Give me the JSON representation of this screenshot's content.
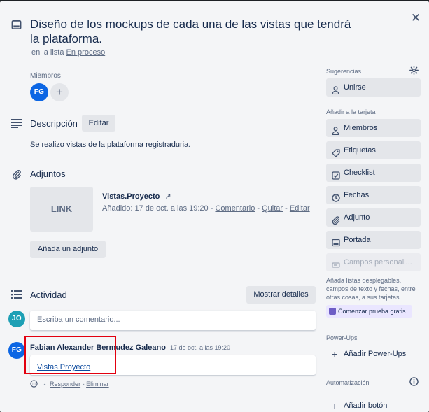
{
  "card": {
    "title": "Diseño de los mockups de cada una de las vistas que tendrá la plataforma.",
    "list_prefix": "en la lista",
    "list_name": "En proceso"
  },
  "members": {
    "label": "Miembros",
    "avatar_initials": "FG",
    "add_symbol": "+"
  },
  "description": {
    "title": "Descripción",
    "edit_label": "Editar",
    "text": "Se realizo vistas de la plataforma registraduria."
  },
  "attachments": {
    "title": "Adjuntos",
    "thumb_label": "LINK",
    "name": "Vistas.Proyecto",
    "arrow": "↗",
    "added": "Añadido: 17 de oct. a las 19:20",
    "sep": "-",
    "comment_link": "Comentario",
    "remove_link": "Quitar",
    "edit_link": "Editar",
    "add_button": "Añada un adjunto"
  },
  "activity": {
    "title": "Actividad",
    "details_button": "Mostrar detalles",
    "input_avatar": "JO",
    "input_placeholder": "Escriba un comentario...",
    "comment": {
      "avatar": "FG",
      "author": "Fabian Alexander Bermudez Galeano",
      "time": "17 de oct. a las 19:20",
      "link_text": "Vistas.Proyecto",
      "sep": "-",
      "reply": "Responder",
      "delete": "Eliminar"
    }
  },
  "sidebar": {
    "suggestions_title": "Sugerencias",
    "join_label": "Unirse",
    "add_to_card_title": "Añadir a la tarjeta",
    "add_items": [
      "Miembros",
      "Etiquetas",
      "Checklist",
      "Fechas",
      "Adjunto",
      "Portada"
    ],
    "custom_fields_label": "Campos personali...",
    "custom_fields_help": "Añada listas desplegables, campos de texto y fechas, entre otras cosas, a sus tarjetas.",
    "trial_label": "Comenzar prueba gratis",
    "powerups_title": "Power-Ups",
    "add_powerups": "Añadir Power-Ups",
    "automation_title": "Automatización",
    "add_button_label": "Añadir botón"
  },
  "colors": {
    "avatar_fg": "#0c66e4",
    "avatar_jo": "#1ea0b5",
    "highlight": "#e2000f"
  }
}
